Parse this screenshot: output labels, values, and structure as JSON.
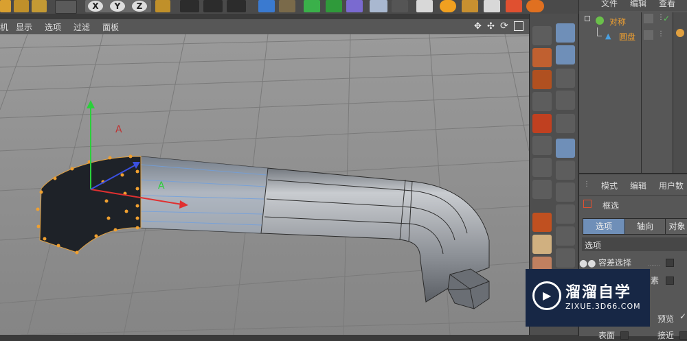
{
  "viewport_menu": [
    "机",
    "显示",
    "选项",
    "过滤",
    "面板"
  ],
  "toolbar_axes": [
    "X",
    "Y",
    "Z"
  ],
  "object_manager": {
    "menu": [
      "文件",
      "编辑",
      "查看"
    ],
    "objects": [
      {
        "name": "对称"
      },
      {
        "name": "圆盘"
      }
    ]
  },
  "attributes": {
    "menu": [
      "模式",
      "编辑",
      "用户数"
    ],
    "tool_name": "框选",
    "tabs": [
      "选项",
      "轴向",
      "对象"
    ],
    "section": "选项",
    "options": [
      {
        "label": "容差选择"
      },
      {
        "label": "素"
      },
      {
        "label": "预览"
      },
      {
        "label": "表面"
      },
      {
        "label": "接近"
      }
    ]
  },
  "watermark": {
    "title": "溜溜自学",
    "url": "ZIXUE.3D66.COM"
  },
  "colors": {
    "accent_blue": "#6f8fb8",
    "object_orange": "#f0a030",
    "watermark_bg": "#172745"
  }
}
